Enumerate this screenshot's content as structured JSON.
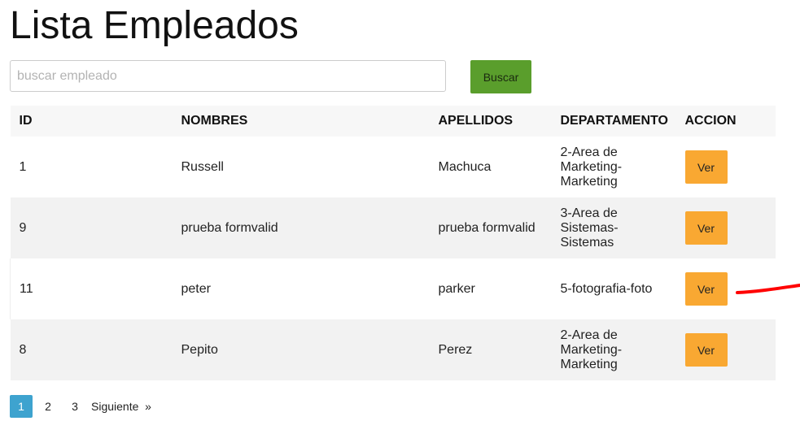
{
  "header": {
    "title": "Lista Empleados"
  },
  "search": {
    "placeholder": "buscar empleado",
    "value": "",
    "button_label": "Buscar"
  },
  "table": {
    "columns": [
      "ID",
      "NOMBRES",
      "APELLIDOS",
      "DEPARTAMENTO",
      "ACCION"
    ],
    "rows": [
      {
        "id": "1",
        "nombres": "Russell",
        "apellidos": "Machuca",
        "departamento": "2-Area de Marketing-Marketing",
        "accion": "Ver"
      },
      {
        "id": "9",
        "nombres": "prueba formvalid",
        "apellidos": "prueba formvalid",
        "departamento": "3-Area de Sistemas-Sistemas",
        "accion": "Ver"
      },
      {
        "id": "11",
        "nombres": "peter",
        "apellidos": "parker",
        "departamento": "5-fotografia-foto",
        "accion": "Ver"
      },
      {
        "id": "8",
        "nombres": "Pepito",
        "apellidos": "Perez",
        "departamento": "2-Area de Marketing-Marketing",
        "accion": "Ver"
      }
    ]
  },
  "pagination": {
    "pages": [
      "1",
      "2",
      "3"
    ],
    "active_page": "1",
    "next_label": "Siguiente  »"
  },
  "colors": {
    "search_button": "#5a9e2c",
    "action_button": "#f9a832",
    "active_page": "#3ea3cf",
    "annotation_stroke": "#ff0000"
  }
}
